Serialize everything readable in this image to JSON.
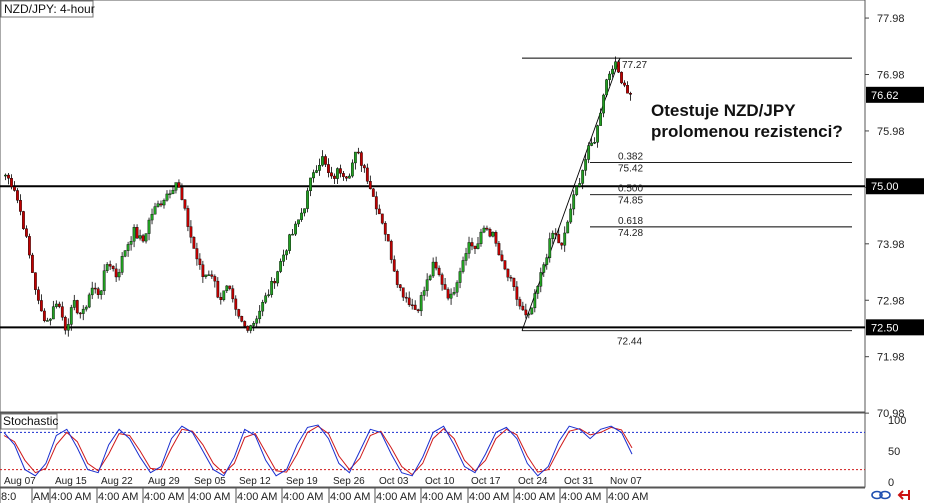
{
  "chart_data": {
    "type": "candlestick",
    "title": "NZD/JPY: 4-hour",
    "annotation": [
      "Otestuje NZD/JPY",
      "prolomenou rezistenci?"
    ],
    "ylim": [
      71.0,
      78.3
    ],
    "y_ticks": [
      "77.98",
      "76.98",
      "75.98",
      "74.98",
      "73.98",
      "72.98",
      "71.98",
      "70.98"
    ],
    "x_labels": [
      "Aug 07",
      "Aug 15",
      "Aug 22",
      "Aug 29",
      "Sep 05",
      "Sep 12",
      "Sep 19",
      "Sep 26",
      "Oct 03",
      "Oct 10",
      "Oct 17",
      "Oct 24",
      "Oct 31",
      "Nov 07"
    ],
    "x_time_labels": [
      "8:0",
      "AM",
      "4:00 AM",
      "4:00 AM",
      "4:00 AM",
      "4:00 AM",
      "4:00 AM",
      "4:00 AM",
      "4:00 AM",
      "4:00 AM",
      "4:00 AM",
      "4:00 AM",
      "4:00 AM",
      "4:00 AM",
      "4:00 AM"
    ],
    "levels": [
      {
        "value": 75.0,
        "label": "75.00"
      },
      {
        "value": 72.5,
        "label": "72.50"
      }
    ],
    "current_price": {
      "value": 76.62,
      "label": "76.62"
    },
    "fibonacci": {
      "high": {
        "value": 77.27,
        "label": "77.27"
      },
      "low": {
        "value": 72.44,
        "label": "72.44"
      },
      "retracements": [
        {
          "ratio": "0.382",
          "value": 75.42,
          "label": "75.42"
        },
        {
          "ratio": "0.500",
          "value": 74.85,
          "label": "74.85"
        },
        {
          "ratio": "0.618",
          "value": 74.28,
          "label": "74.28"
        }
      ]
    },
    "price_path": [
      75.2,
      75.0,
      74.4,
      73.6,
      72.8,
      72.6,
      73.0,
      72.5,
      72.9,
      72.7,
      73.2,
      73.1,
      73.7,
      73.4,
      73.9,
      74.2,
      74.0,
      74.5,
      74.7,
      74.9,
      75.1,
      74.5,
      73.9,
      73.4,
      73.5,
      73.0,
      73.2,
      72.7,
      72.5,
      72.6,
      72.9,
      73.2,
      73.6,
      74.0,
      74.3,
      74.7,
      75.3,
      75.5,
      75.1,
      75.3,
      75.2,
      75.6,
      75.3,
      74.8,
      74.4,
      73.8,
      73.2,
      73.0,
      72.8,
      73.2,
      73.6,
      73.3,
      73.0,
      73.5,
      74.0,
      73.9,
      74.3,
      74.1,
      73.6,
      73.3,
      72.9,
      72.6,
      73.1,
      73.7,
      74.2,
      73.9,
      74.6,
      75.1,
      75.6,
      75.9,
      76.8,
      77.2,
      76.9,
      76.6
    ],
    "stochastic": {
      "title": "Stochastic",
      "y_ticks": [
        "100",
        "50",
        "0"
      ],
      "levels": [
        80,
        20
      ],
      "k": [
        80,
        60,
        20,
        10,
        30,
        75,
        85,
        55,
        20,
        15,
        60,
        85,
        70,
        40,
        15,
        25,
        70,
        90,
        80,
        50,
        20,
        10,
        40,
        85,
        75,
        35,
        10,
        20,
        60,
        88,
        92,
        70,
        30,
        15,
        50,
        85,
        80,
        45,
        15,
        10,
        40,
        80,
        90,
        60,
        25,
        15,
        45,
        80,
        88,
        70,
        30,
        10,
        25,
        65,
        90,
        85,
        70,
        85,
        90,
        80,
        45
      ],
      "d": [
        75,
        65,
        35,
        15,
        22,
        60,
        80,
        65,
        30,
        18,
        45,
        78,
        75,
        50,
        22,
        20,
        55,
        85,
        82,
        60,
        30,
        14,
        30,
        72,
        78,
        48,
        18,
        16,
        45,
        80,
        90,
        78,
        42,
        20,
        38,
        75,
        82,
        55,
        25,
        12,
        30,
        70,
        86,
        70,
        35,
        18,
        35,
        70,
        85,
        76,
        42,
        16,
        20,
        52,
        82,
        86,
        76,
        80,
        88,
        84,
        55
      ]
    },
    "grid": false
  }
}
